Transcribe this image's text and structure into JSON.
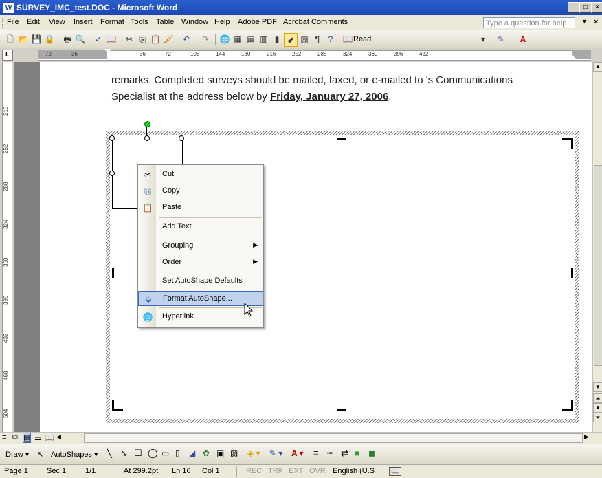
{
  "window": {
    "title": "SURVEY_IMC_test.DOC - Microsoft Word",
    "app_icon": "word-icon",
    "controls": [
      "minimize",
      "maximize",
      "close"
    ]
  },
  "menubar": {
    "items": [
      "File",
      "Edit",
      "View",
      "Insert",
      "Format",
      "Tools",
      "Table",
      "Window",
      "Help",
      "Adobe PDF",
      "Acrobat Comments"
    ],
    "ask_placeholder": "Type a question for help"
  },
  "toolbar": {
    "read_label": "Read",
    "pilcrow": "¶"
  },
  "ruler": {
    "horizontal_labels": [
      "72",
      "36",
      "36",
      "72",
      "108",
      "144",
      "180",
      "216",
      "252",
      "288",
      "324",
      "360",
      "396",
      "432"
    ],
    "vertical_labels": [
      "216",
      "252",
      "288",
      "324",
      "360",
      "396",
      "432",
      "468",
      "504"
    ],
    "tab_marker": "L"
  },
  "document": {
    "line1": "remarks.  Completed surveys should be mailed, faxed, or e-mailed to       's Communications",
    "line2_prefix": "Specialist at the address below by ",
    "line2_date": "Friday, January 27, 2006",
    "line2_suffix": "."
  },
  "context_menu": {
    "items": [
      {
        "label": "Cut",
        "icon": "scissors-icon"
      },
      {
        "label": "Copy",
        "icon": "copy-icon"
      },
      {
        "label": "Paste",
        "icon": "paste-icon"
      },
      {
        "label": "Add Text",
        "icon": ""
      },
      {
        "label": "Grouping",
        "icon": "",
        "submenu": true
      },
      {
        "label": "Order",
        "icon": "",
        "submenu": true
      },
      {
        "label": "Set AutoShape Defaults",
        "icon": ""
      },
      {
        "label": "Format AutoShape...",
        "icon": "format-shape-icon",
        "highlighted": true
      },
      {
        "label": "Hyperlink...",
        "icon": "hyperlink-icon"
      }
    ]
  },
  "drawbar": {
    "draw_label": "Draw",
    "autoshapes_label": "AutoShapes"
  },
  "statusbar": {
    "page": "Page 1",
    "sec": "Sec 1",
    "pages": "1/1",
    "at": "At 299.2pt",
    "ln": "Ln 16",
    "col": "Col 1",
    "rec": "REC",
    "trk": "TRK",
    "ext": "EXT",
    "ovr": "OVR",
    "language": "English (U.S"
  }
}
